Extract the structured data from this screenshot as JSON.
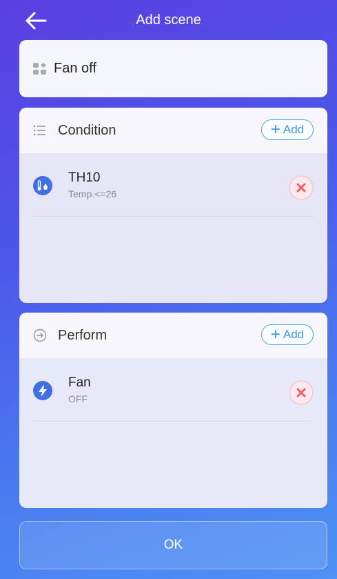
{
  "header": {
    "title": "Add scene",
    "back_icon": "arrow-left-icon"
  },
  "scene": {
    "name": "Fan off",
    "icon": "grid-icon"
  },
  "condition": {
    "title": "Condition",
    "icon": "list-icon",
    "add_label": "Add",
    "items": [
      {
        "name": "TH10",
        "detail": "Temp.<=26",
        "icon": "thermometer-icon"
      }
    ]
  },
  "perform": {
    "title": "Perform",
    "icon": "arrow-circle-icon",
    "add_label": "Add",
    "items": [
      {
        "name": "Fan",
        "detail": "OFF",
        "icon": "lightning-icon"
      }
    ]
  },
  "ok_label": "OK",
  "colors": {
    "accent": "#3a9be8",
    "remove": "#f05a5a",
    "device_icon": "#3f6fe0"
  }
}
